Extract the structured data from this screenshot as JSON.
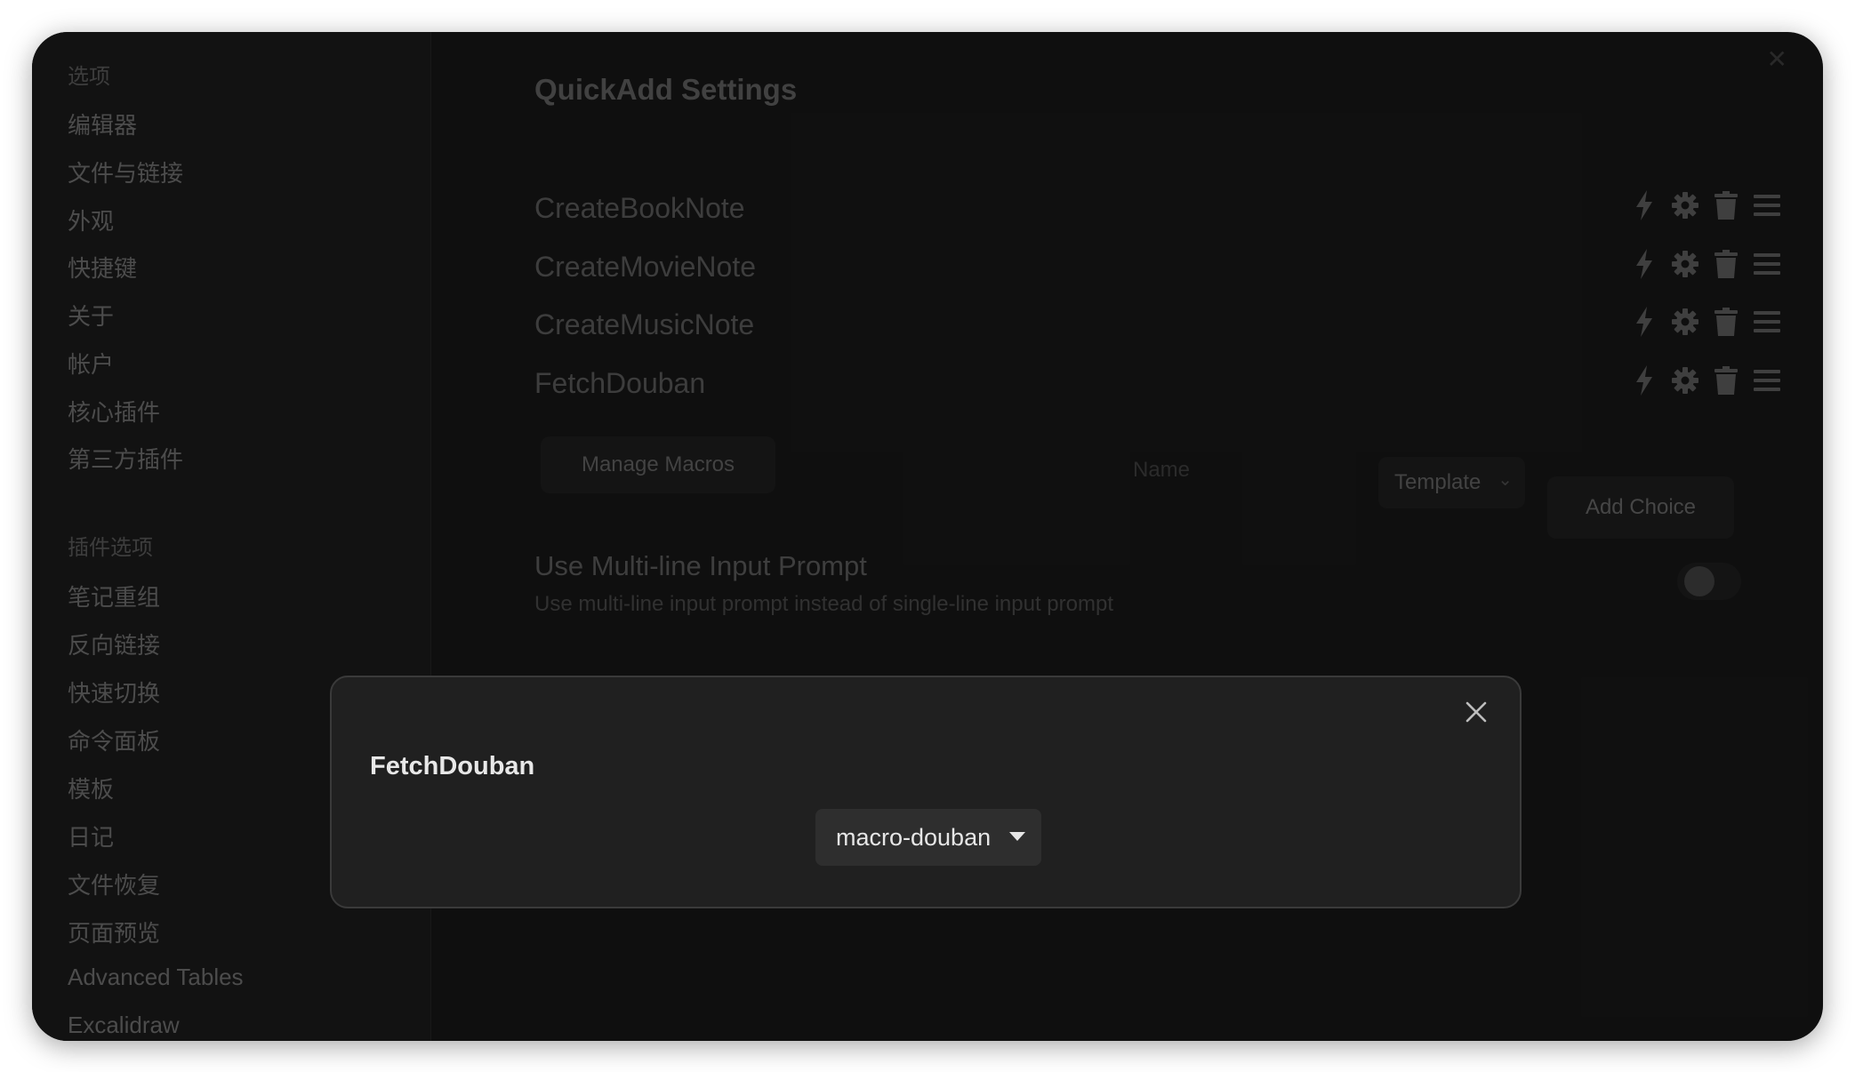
{
  "sidebar": {
    "group1_title": "选项",
    "group1_items": [
      "编辑器",
      "文件与链接",
      "外观",
      "快捷键",
      "关于",
      "帐户",
      "核心插件",
      "第三方插件"
    ],
    "group2_title": "插件选项",
    "group2_items": [
      "笔记重组",
      "反向链接",
      "快速切换",
      "命令面板",
      "模板",
      "日记",
      "文件恢复",
      "页面预览",
      "Advanced Tables",
      "Excalidraw"
    ]
  },
  "main": {
    "title": "QuickAdd Settings",
    "choices": [
      {
        "name": "CreateBookNote",
        "icons": [
          "lightning-icon",
          "gear-icon",
          "trash-icon",
          "drag-handle-icon"
        ]
      },
      {
        "name": "CreateMovieNote",
        "icons": [
          "lightning-icon",
          "gear-icon",
          "trash-icon",
          "drag-handle-icon"
        ]
      },
      {
        "name": "CreateMusicNote",
        "icons": [
          "lightning-icon",
          "gear-icon",
          "trash-icon",
          "drag-handle-icon"
        ]
      },
      {
        "name": "FetchDouban",
        "icons": [
          "lightning-icon",
          "gear-icon",
          "trash-icon",
          "drag-handle-icon"
        ]
      }
    ],
    "manage_macros_label": "Manage Macros",
    "name_placeholder": "Name",
    "choice_type_value": "Template",
    "add_choice_label": "Add Choice",
    "setting": {
      "name": "Use Multi-line Input Prompt",
      "description": "Use multi-line input prompt instead of single-line input prompt",
      "enabled": false
    }
  },
  "modal": {
    "title": "FetchDouban",
    "macro_selected": "macro-douban"
  },
  "colors": {
    "window_bg": "#161616",
    "modal_bg": "#202020",
    "modal_text": "#e8e8e8"
  }
}
